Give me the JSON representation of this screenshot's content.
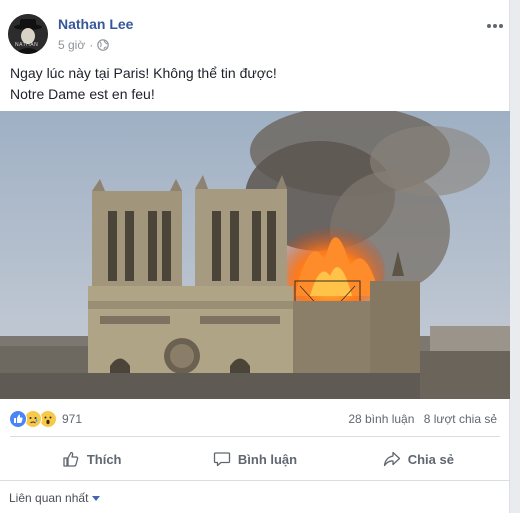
{
  "post": {
    "author": "Nathan Lee",
    "time": "5 giờ",
    "separator": "·",
    "privacy_icon": "globe-icon",
    "more_icon": "ellipsis-icon",
    "avatar_text": "NATHAN",
    "message_lines": [
      "Ngay lúc này tại Paris! Không thể tin được!",
      "Notre Dame est en feu!"
    ],
    "photo_icon": "notre-dame-fire-photo"
  },
  "reactions": {
    "icons": [
      "like-icon",
      "sad-icon",
      "wow-icon"
    ],
    "count": "971",
    "comments": "28 bình luận",
    "shares": "8 lượt chia sẻ"
  },
  "actions": {
    "like_label": "Thích",
    "comment_label": "Bình luận",
    "share_label": "Chia sẻ"
  },
  "comments": {
    "sort_label": "Liên quan nhất"
  },
  "colors": {
    "author": "#365899",
    "like_blue": "#4a84f6",
    "emoji_yellow": "#f7c948"
  }
}
